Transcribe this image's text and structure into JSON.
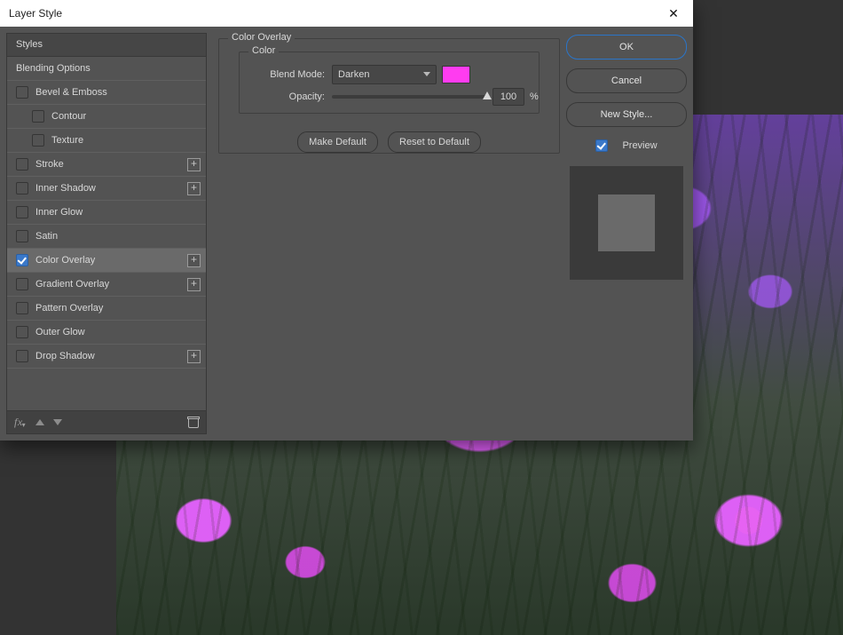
{
  "window": {
    "title": "Layer Style"
  },
  "styles_panel": {
    "header": "Styles",
    "blending_options": "Blending Options",
    "items": [
      {
        "label": "Bevel & Emboss",
        "checked": false,
        "has_add": false
      },
      {
        "label": "Contour",
        "checked": false,
        "sub": true
      },
      {
        "label": "Texture",
        "checked": false,
        "sub": true
      },
      {
        "label": "Stroke",
        "checked": false,
        "has_add": true
      },
      {
        "label": "Inner Shadow",
        "checked": false,
        "has_add": true
      },
      {
        "label": "Inner Glow",
        "checked": false
      },
      {
        "label": "Satin",
        "checked": false
      },
      {
        "label": "Color Overlay",
        "checked": true,
        "has_add": true,
        "selected": true
      },
      {
        "label": "Gradient Overlay",
        "checked": false,
        "has_add": true
      },
      {
        "label": "Pattern Overlay",
        "checked": false
      },
      {
        "label": "Outer Glow",
        "checked": false
      },
      {
        "label": "Drop Shadow",
        "checked": false,
        "has_add": true
      }
    ],
    "footer": {
      "fx_label": "fx"
    }
  },
  "settings": {
    "fieldset_title": "Color Overlay",
    "inner_title": "Color",
    "blend_mode_label": "Blend Mode:",
    "blend_mode_value": "Darken",
    "color_swatch": "#ff3cf0",
    "opacity_label": "Opacity:",
    "opacity_value": "100",
    "opacity_suffix": "%",
    "make_default": "Make Default",
    "reset_default": "Reset to Default"
  },
  "right": {
    "ok": "OK",
    "cancel": "Cancel",
    "new_style": "New Style...",
    "preview_label": "Preview",
    "preview_checked": true
  }
}
